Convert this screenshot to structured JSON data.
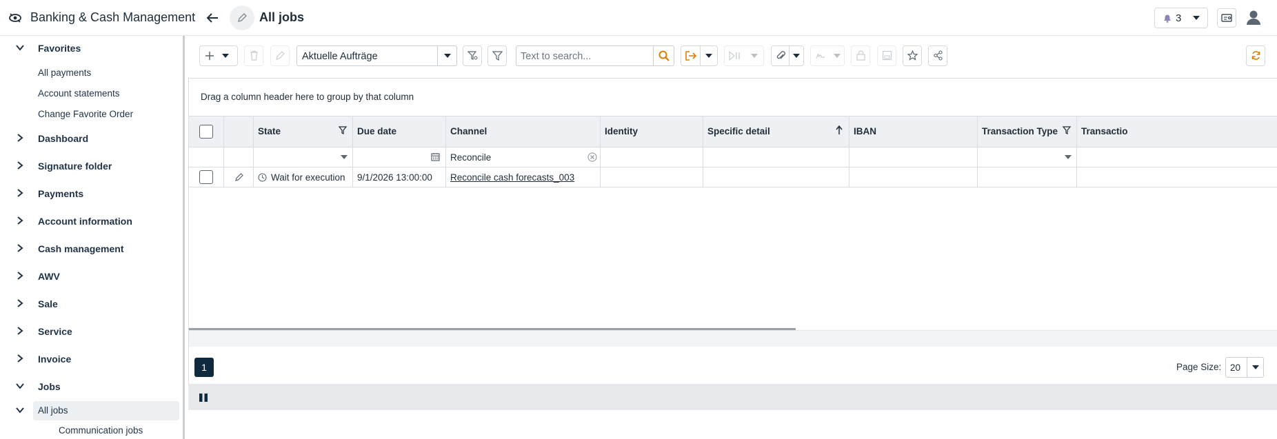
{
  "app": {
    "title": "Banking & Cash Management",
    "icon": "banking-app-icon"
  },
  "header": {
    "page_title": "All jobs",
    "notifications_count": "3"
  },
  "sidebar": {
    "favorites_label": "Favorites",
    "favorites_items": [
      "All payments",
      "Account statements",
      "Change Favorite Order"
    ],
    "sections": [
      "Dashboard",
      "Signature folder",
      "Payments",
      "Account information",
      "Cash management",
      "AWV",
      "Sale",
      "Service",
      "Invoice"
    ],
    "jobs_label": "Jobs",
    "jobs_items": [
      "All jobs",
      "Communication jobs"
    ]
  },
  "toolbar": {
    "view_select": "Aktuelle Aufträge",
    "search_placeholder": "Text to search...",
    "accent_color": "#e07b00"
  },
  "grid": {
    "group_hint": "Drag a column header here to group by that column",
    "columns": [
      "State",
      "Due date",
      "Channel",
      "Identity",
      "Specific detail",
      "IBAN",
      "Transaction Type",
      "Transactio"
    ],
    "filters": {
      "channel": "Reconcile"
    },
    "rows": [
      {
        "state": "Wait for execution",
        "due_date": "9/1/2026 13:00:00",
        "channel": "Reconcile cash forecasts_003"
      }
    ]
  },
  "pager": {
    "current_page": "1",
    "page_size_label": "Page Size:",
    "page_size": "20"
  }
}
